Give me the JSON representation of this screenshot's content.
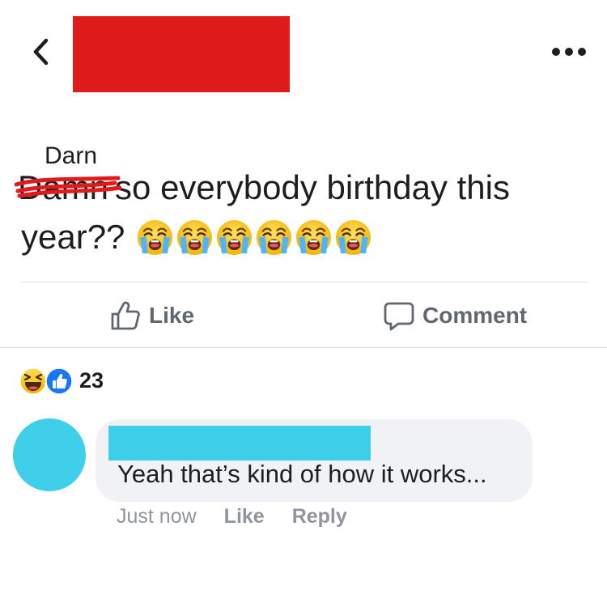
{
  "post": {
    "correction_word": "Darn",
    "struck_word": "Damn",
    "line1_text": "so everybody birthday this",
    "line2_text": "year??",
    "emoji_icon": "loudly-crying-face-icon",
    "emoji_count": 6
  },
  "actions": {
    "like_label": "Like",
    "comment_label": "Comment"
  },
  "reactions": {
    "icons": [
      "laughing-face-icon",
      "thumbs-up-icon"
    ],
    "count": "23"
  },
  "comment": {
    "text": "Yeah that’s kind of how it works...",
    "time": "Just now",
    "like_label": "Like",
    "reply_label": "Reply"
  },
  "colors": {
    "name_redaction": "#e01b1b",
    "commenter_redaction": "#3dcfea",
    "like_blue": "#1877f2"
  }
}
